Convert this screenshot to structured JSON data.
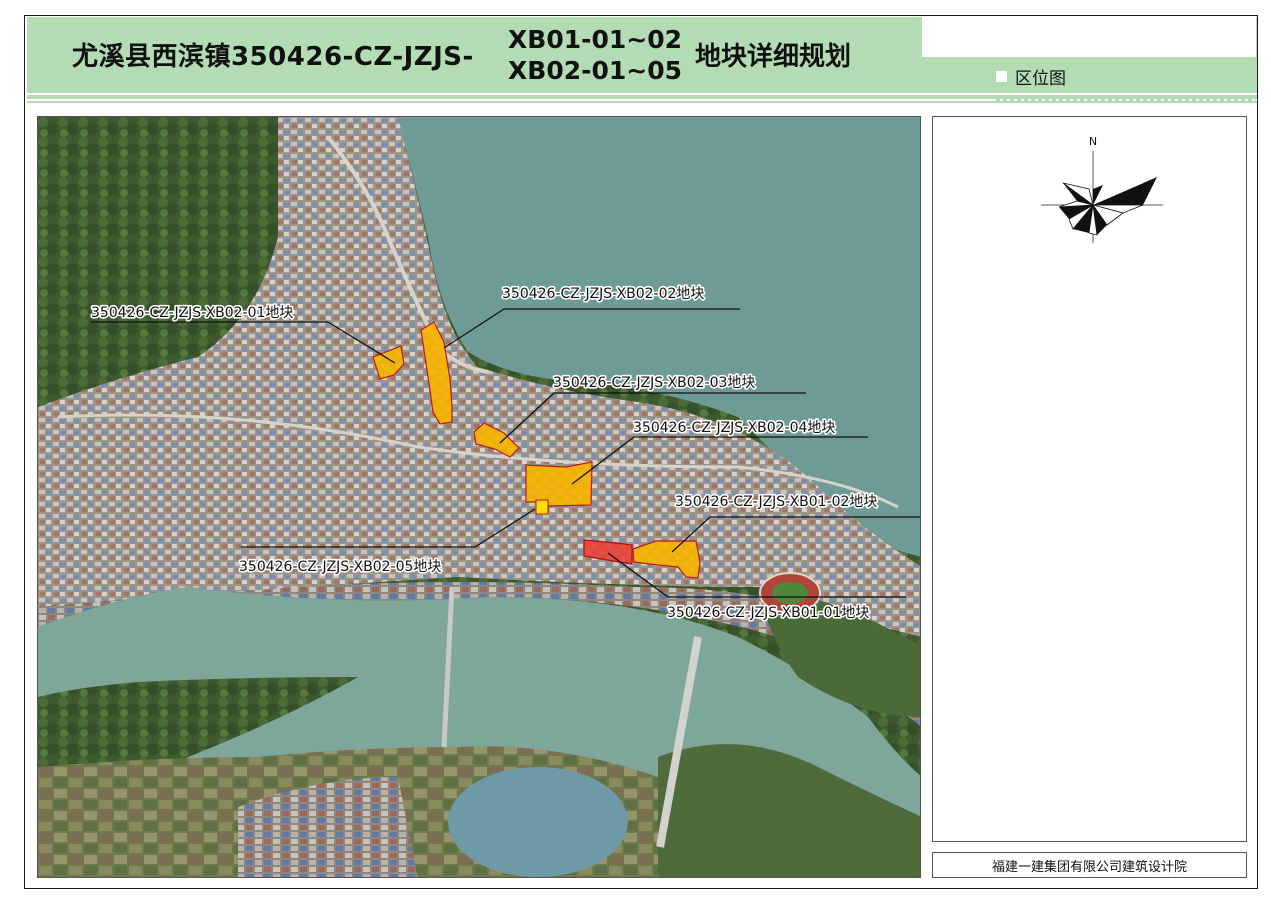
{
  "header": {
    "title_prefix": "尤溪县西滨镇350426-CZ-JZJS-",
    "title_code_line1": "XB01-01~02",
    "title_code_line2": "XB02-01~05",
    "title_suffix": "地块详细规划",
    "locator_label": "区位图"
  },
  "map": {
    "parcels": [
      {
        "id": "xb02-01",
        "label": "350426-CZ-JZJS-XB02-01地块",
        "color": "#f5b400"
      },
      {
        "id": "xb02-02",
        "label": "350426-CZ-JZJS-XB02-02地块",
        "color": "#f5b400"
      },
      {
        "id": "xb02-03",
        "label": "350426-CZ-JZJS-XB02-03地块",
        "color": "#f5b400"
      },
      {
        "id": "xb02-04",
        "label": "350426-CZ-JZJS-XB02-04地块",
        "color": "#f5b400"
      },
      {
        "id": "xb02-05",
        "label": "350426-CZ-JZJS-XB02-05地块",
        "color": "#ffe600"
      },
      {
        "id": "xb01-02",
        "label": "350426-CZ-JZJS-XB01-02地块",
        "color": "#f5b400"
      },
      {
        "id": "xb01-01",
        "label": "350426-CZ-JZJS-XB01-01地块",
        "color": "#e8443a"
      }
    ]
  },
  "compass": {
    "north_label": "N"
  },
  "footer": {
    "org": "福建一建集团有限公司建筑设计院"
  }
}
